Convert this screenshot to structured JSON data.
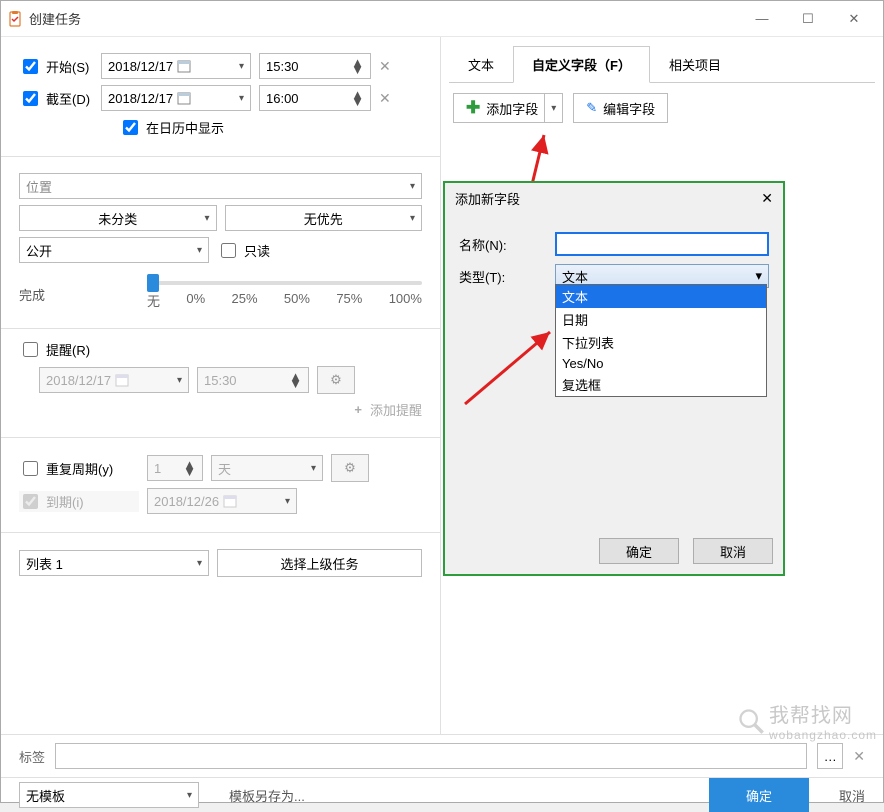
{
  "window": {
    "title": "创建任务"
  },
  "winbtns": {
    "min": "—",
    "max": "☐",
    "close": "✕"
  },
  "start": {
    "label": "开始(S)",
    "date": "2018/12/17",
    "time": "15:30"
  },
  "end": {
    "label": "截至(D)",
    "date": "2018/12/17",
    "time": "16:00"
  },
  "show_calendar": {
    "label": "在日历中显示"
  },
  "location": {
    "placeholder": "位置"
  },
  "category": {
    "value": "未分类"
  },
  "priority": {
    "value": "无优先"
  },
  "visibility": {
    "value": "公开"
  },
  "readonly": {
    "label": "只读"
  },
  "progress": {
    "label": "完成",
    "ticks": [
      "无",
      "0%",
      "25%",
      "50%",
      "75%",
      "100%"
    ]
  },
  "reminder": {
    "label": "提醒(R)",
    "date": "2018/12/17",
    "time": "15:30",
    "add": "添加提醒"
  },
  "repeat": {
    "label": "重复周期(y)",
    "count": "1",
    "unit": "天",
    "due_label": "到期(i)",
    "due_date": "2018/12/26"
  },
  "list": {
    "value": "列表 1",
    "parent_btn": "选择上级任务"
  },
  "tags": {
    "label": "标签"
  },
  "footer": {
    "template": "无模板",
    "saveas": "模板另存为...",
    "ok": "确定",
    "cancel": "取消"
  },
  "tabs": {
    "text": "文本",
    "custom": "自定义字段（F）",
    "related": "相关项目"
  },
  "toolbar": {
    "add": "添加字段",
    "edit": "编辑字段"
  },
  "dialog": {
    "title": "添加新字段",
    "name_label": "名称(N):",
    "type_label": "类型(T):",
    "type_value": "文本",
    "options": [
      "文本",
      "日期",
      "下拉列表",
      "Yes/No",
      "复选框"
    ],
    "ok": "确定",
    "cancel": "取消"
  },
  "watermark": {
    "text": "我帮找网",
    "url": "wobangzhao.com"
  }
}
